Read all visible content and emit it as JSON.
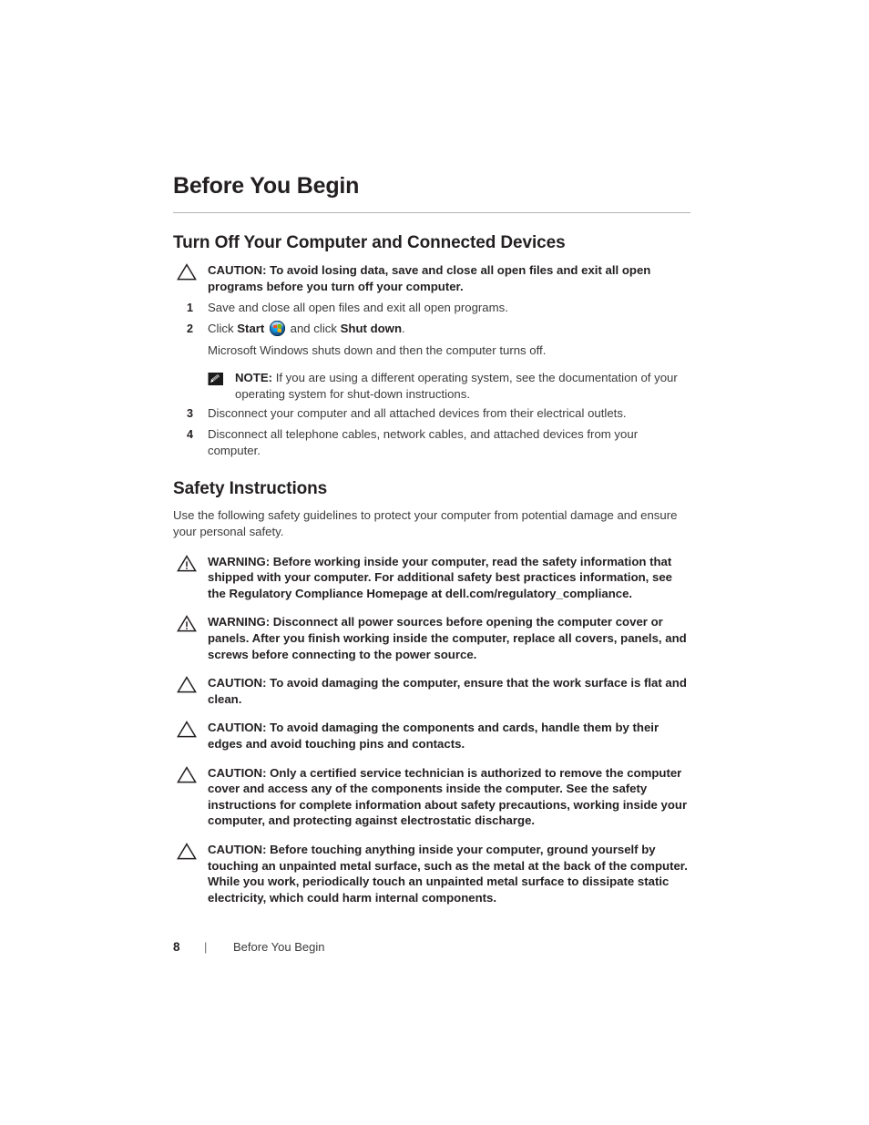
{
  "document": {
    "chapter_title": "Before You Begin"
  },
  "sections": {
    "turn_off": {
      "heading": "Turn Off Your Computer and Connected Devices",
      "caution": {
        "label": "CAUTION:",
        "text": " To avoid losing data, save and close all open files and exit all open programs before you turn off your computer."
      },
      "steps": [
        {
          "num": "1",
          "text": "Save and close all open files and exit all open programs."
        },
        {
          "num": "2",
          "text_before": "Click ",
          "bold_1": "Start",
          "text_middle": " and click ",
          "bold_2": "Shut down",
          "text_after": ".",
          "icon": "windows-start-orb-icon",
          "sub_text": "Microsoft Windows shuts down and then the computer turns off.",
          "note": {
            "label": "NOTE:",
            "text": " If you are using a different operating system, see the documentation of your operating system for shut-down instructions."
          }
        },
        {
          "num": "3",
          "text": "Disconnect your computer and all attached devices from their electrical outlets."
        },
        {
          "num": "4",
          "text": "Disconnect all telephone cables, network cables, and attached devices from your computer."
        }
      ]
    },
    "safety": {
      "heading": "Safety Instructions",
      "intro": "Use the following safety guidelines to protect your computer from potential damage and ensure your personal safety.",
      "admonitions": [
        {
          "type": "warning",
          "icon": "warning-triangle-icon",
          "label": "WARNING:",
          "text": "  Before working inside your computer, read the safety information that shipped with your computer. For additional safety best practices information, see the Regulatory Compliance Homepage at dell.com/regulatory_compliance."
        },
        {
          "type": "warning",
          "icon": "warning-triangle-icon",
          "label": "WARNING:",
          "text": "  Disconnect all power sources before opening the computer cover or panels. After you finish working inside the computer, replace all covers, panels, and screws before connecting to the power source."
        },
        {
          "type": "caution",
          "icon": "caution-triangle-icon",
          "label": "CAUTION:",
          "text": " To avoid damaging the computer, ensure that the work surface is flat and clean."
        },
        {
          "type": "caution",
          "icon": "caution-triangle-icon",
          "label": "CAUTION:",
          "text": " To avoid damaging the components and cards, handle them by their edges and avoid touching pins and contacts."
        },
        {
          "type": "caution",
          "icon": "caution-triangle-icon",
          "label": "CAUTION:",
          "text": " Only a certified service technician is authorized to remove the computer cover and access any of the components inside the computer. See the safety instructions for complete information about safety precautions, working inside your computer, and protecting against electrostatic discharge."
        },
        {
          "type": "caution",
          "icon": "caution-triangle-icon",
          "label": "CAUTION:",
          "text": " Before touching anything inside your computer, ground yourself by touching an unpainted metal surface, such as the metal at the back of the computer. While you work, periodically touch an unpainted metal surface to dissipate static electricity, which could harm internal components."
        }
      ]
    }
  },
  "footer": {
    "page_number": "8",
    "separator": "|",
    "chapter": "Before You Begin"
  },
  "colors": {
    "text": "#231f20",
    "body_text": "#3b3b3c",
    "rule": "#b3b3b3",
    "background": "#ffffff"
  }
}
